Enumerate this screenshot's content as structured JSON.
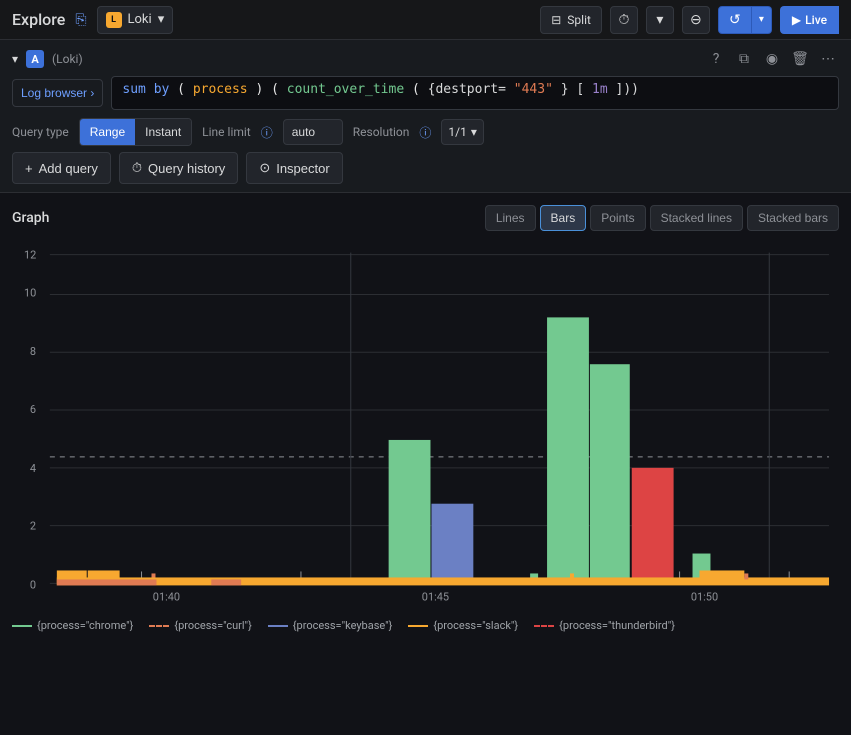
{
  "topbar": {
    "title": "Explore",
    "datasource": {
      "label": "Loki",
      "icon": "L"
    },
    "split_label": "Split",
    "run_label": "Live"
  },
  "query": {
    "collapse_icon": "▾",
    "letter": "A",
    "datasource_name": "(Loki)",
    "log_browser_label": "Log browser ›",
    "query_text": "sum by (process) (count_over_time({destport=\"443\"} [1m]))",
    "query_type_label": "Query type",
    "range_label": "Range",
    "instant_label": "Instant",
    "line_limit_label": "Line limit",
    "line_limit_value": "auto",
    "resolution_label": "Resolution",
    "resolution_value": "1/1"
  },
  "actions": {
    "add_query_label": "Add query",
    "query_history_label": "Query history",
    "inspector_label": "Inspector"
  },
  "graph": {
    "title": "Graph",
    "type_buttons": [
      "Lines",
      "Bars",
      "Points",
      "Stacked lines",
      "Stacked bars"
    ],
    "active_type": "Bars",
    "y_labels": [
      "0",
      "2",
      "4",
      "6",
      "8",
      "10",
      "12"
    ],
    "x_labels": [
      "01:40",
      "01:45",
      "01:50"
    ],
    "dashed_line_y": 4.4
  },
  "legend": [
    {
      "id": "chrome",
      "label": "{process=\"chrome\"}",
      "color": "#73c990",
      "dash": false
    },
    {
      "id": "curl",
      "label": "{process=\"curl\"}",
      "color": "#e07b53",
      "dash": true
    },
    {
      "id": "keybase",
      "label": "{process=\"keybase\"}",
      "color": "#6b80c4",
      "dash": false
    },
    {
      "id": "slack",
      "label": "{process=\"slack\"}",
      "color": "#f7a830",
      "dash": false
    },
    {
      "id": "thunderbird",
      "label": "{process=\"thunderbird\"}",
      "color": "#d44",
      "dash": true
    }
  ],
  "icons": {
    "share": "⎘",
    "chevron_down": "▾",
    "split_icon": "⊟",
    "clock": "⏱",
    "zoom_out": "⊖",
    "refresh": "↺",
    "play": "▶",
    "help": "?",
    "copy": "⧉",
    "eye": "◉",
    "trash": "🗑",
    "more": "⋯",
    "plus": "+",
    "history": "⏱",
    "inspector": "⊙"
  }
}
